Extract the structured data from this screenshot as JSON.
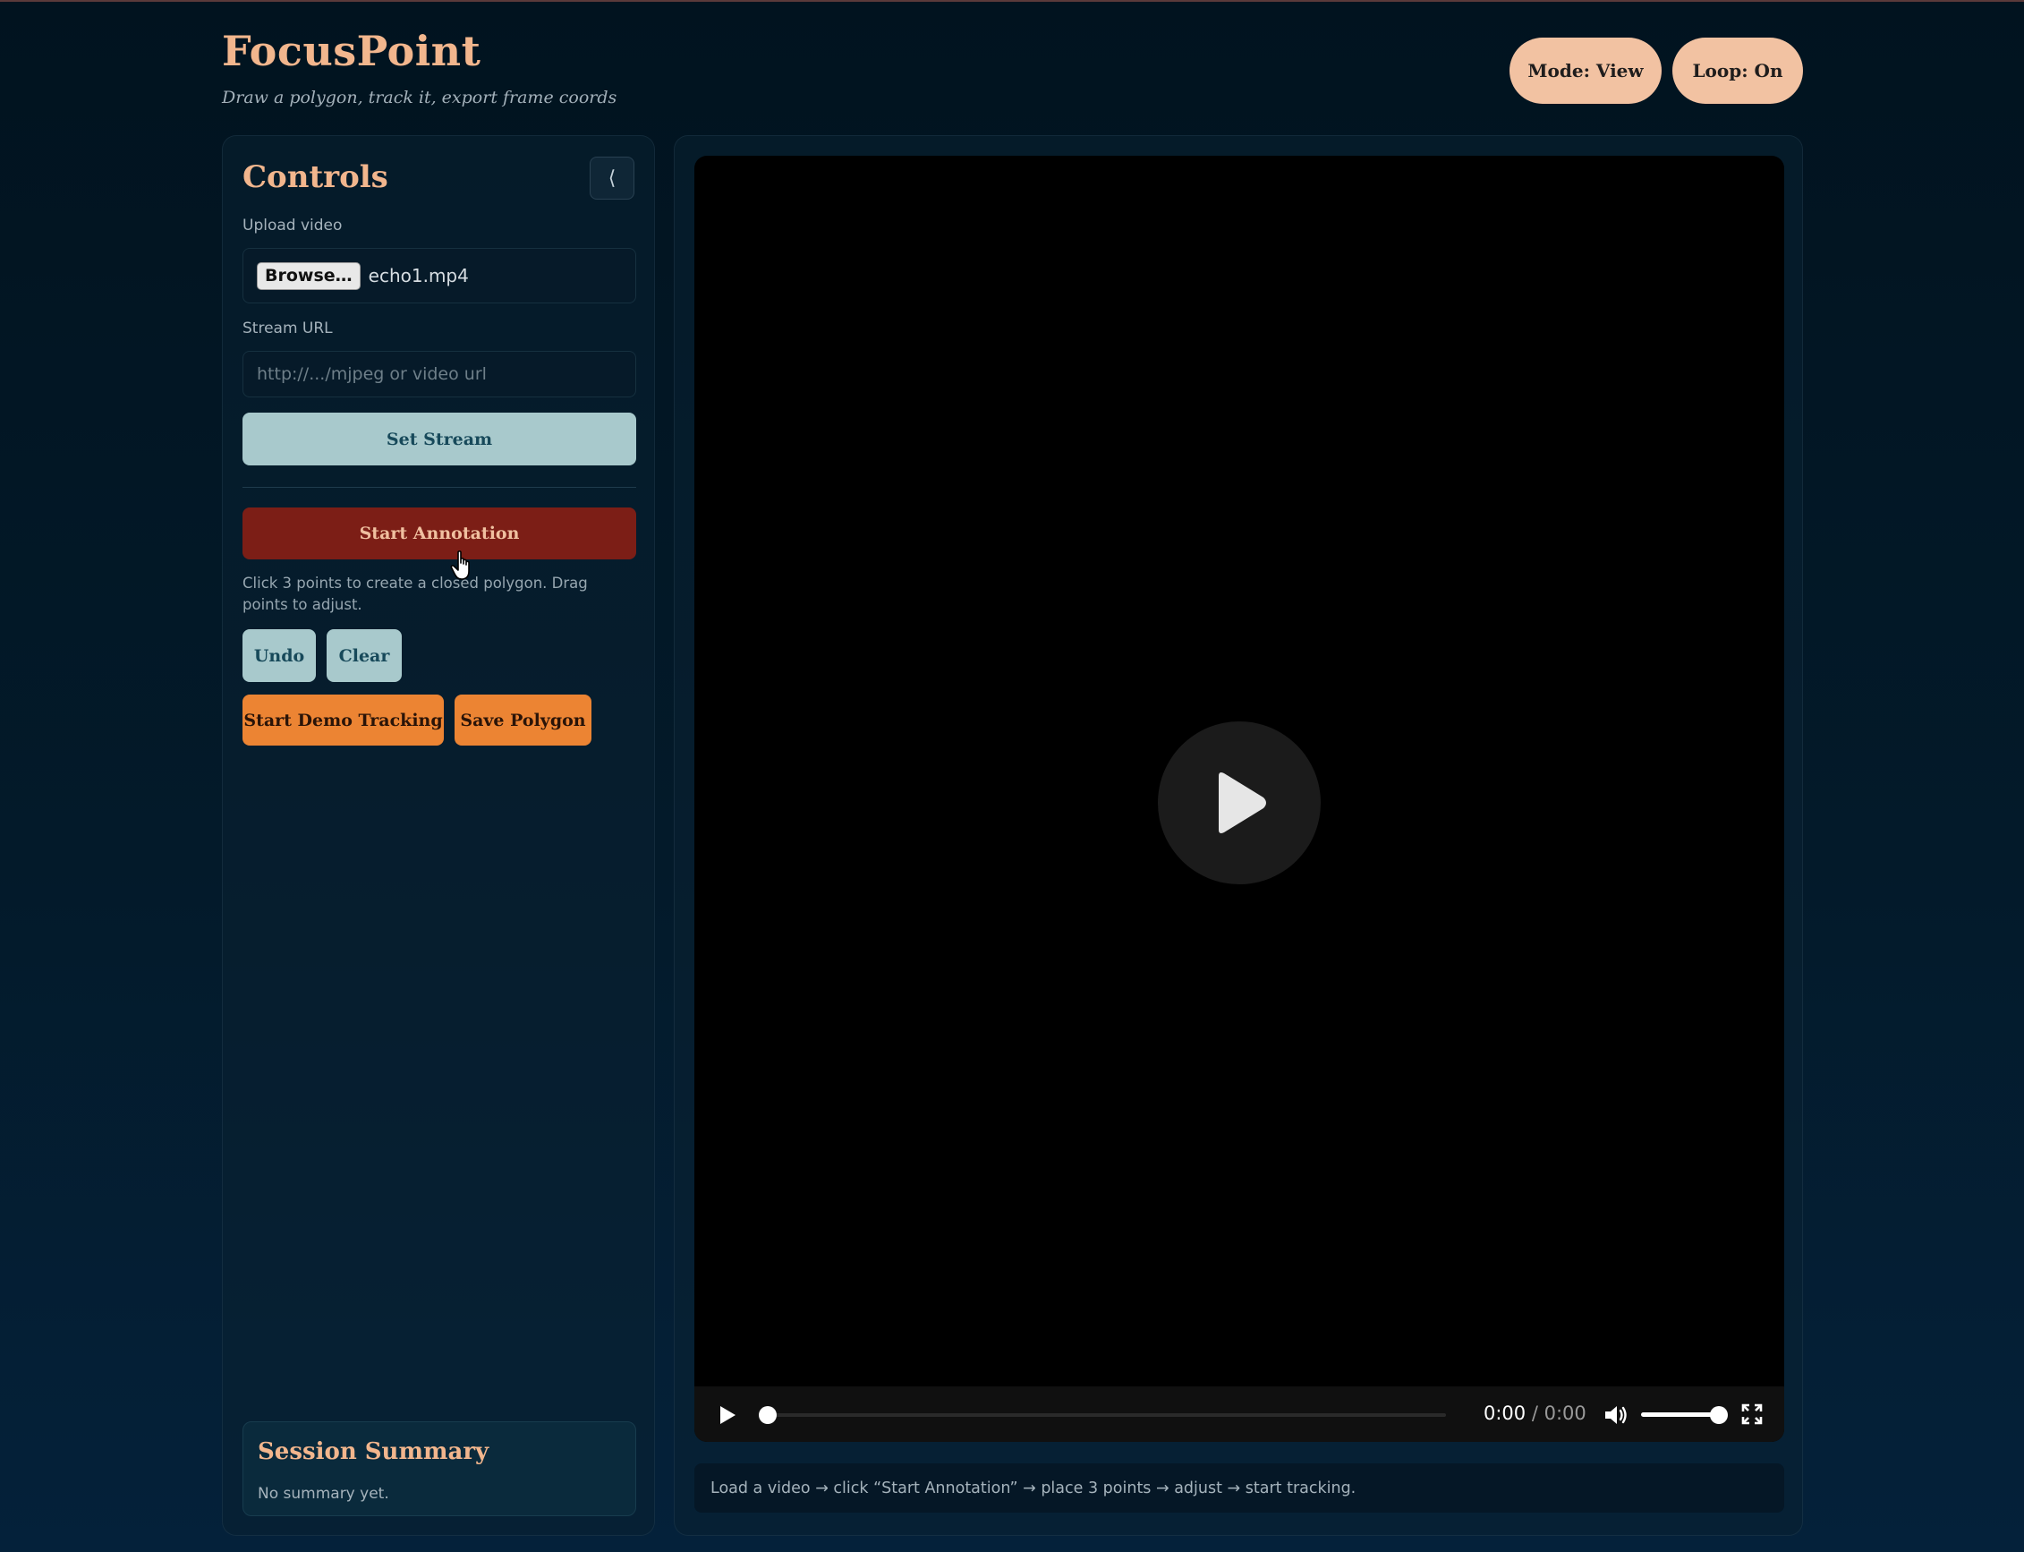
{
  "header": {
    "title": "FocusPoint",
    "subtitle": "Draw a polygon, track it, export frame coords",
    "mode_label": "Mode: View",
    "loop_label": "Loop: On"
  },
  "controls": {
    "title": "Controls",
    "collapse_glyph": "⟨",
    "upload_label": "Upload video",
    "browse_label": "Browse…",
    "file_name": "echo1.mp4",
    "stream_label": "Stream URL",
    "stream_placeholder": "http://.../mjpeg or video url",
    "set_stream_label": "Set Stream",
    "start_annotation_label": "Start Annotation",
    "hint": "Click 3 points to create a closed polygon. Drag points to adjust.",
    "undo_label": "Undo",
    "clear_label": "Clear",
    "demo_tracking_label": "Start Demo Tracking",
    "save_polygon_label": "Save Polygon"
  },
  "summary": {
    "title": "Session Summary",
    "text": "No summary yet."
  },
  "player": {
    "current_time": "0:00",
    "separator": "/",
    "duration": "0:00",
    "progress": 0,
    "volume": 1
  },
  "status": {
    "text": "Load a video → click “Start Annotation” → place 3 points → adjust → start tracking."
  },
  "colors": {
    "accent": "#f2b68d",
    "danger": "#7c1e16",
    "orange": "#ec8433",
    "teal": "#a8c9cc"
  }
}
